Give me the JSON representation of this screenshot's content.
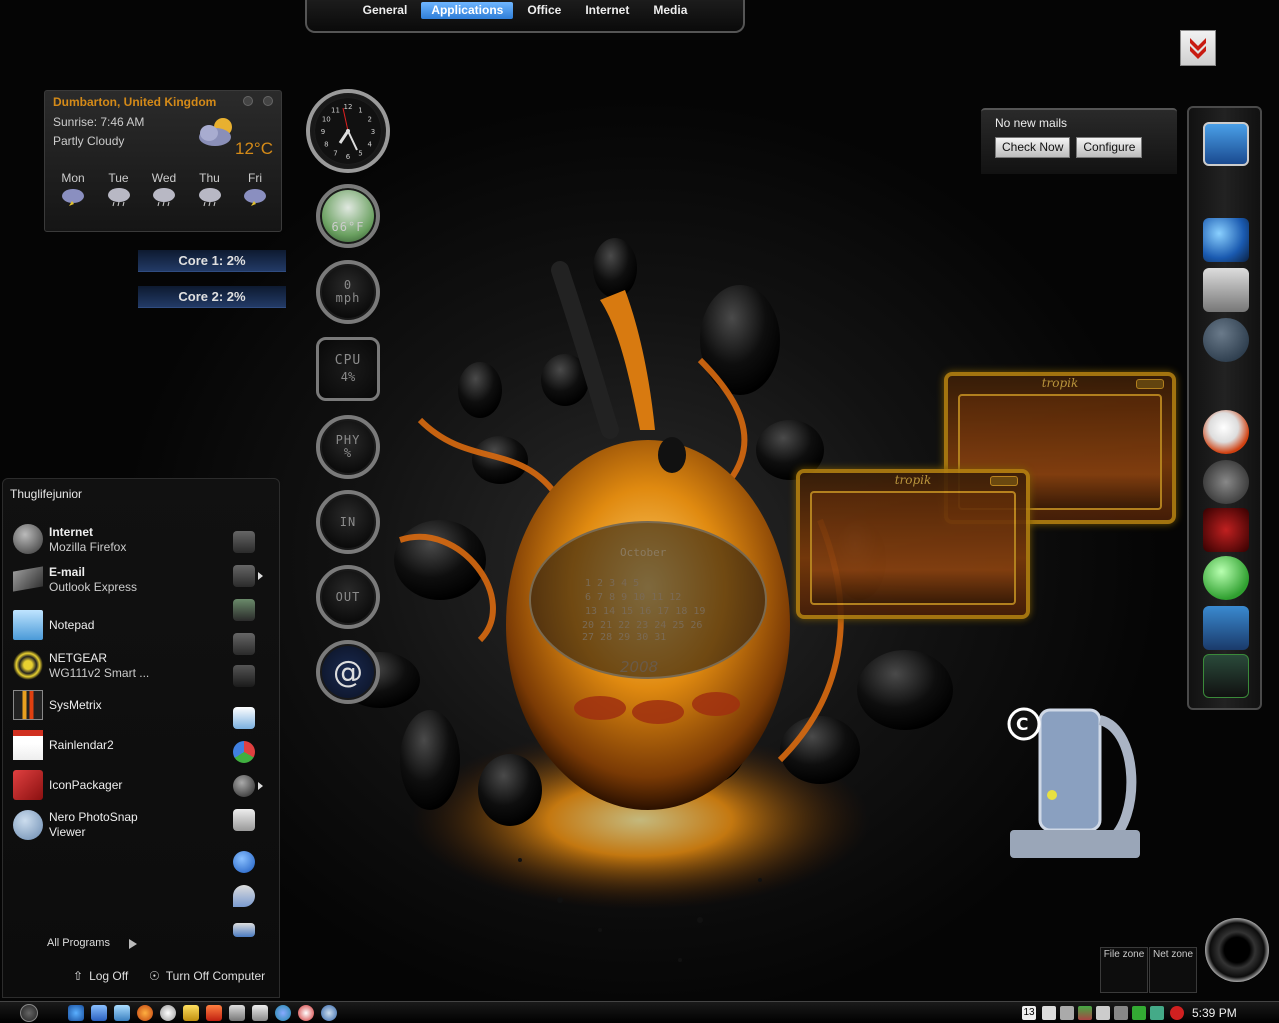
{
  "top_dock": {
    "tabs": [
      "General",
      "Applications",
      "Office",
      "Internet",
      "Media"
    ],
    "active_tab": "Applications"
  },
  "weather": {
    "location": "Dumbarton, United Kingdom",
    "sunrise": "Sunrise: 7:46 AM",
    "condition": "Partly Cloudy",
    "temperature": "12°C",
    "forecast": [
      {
        "day": "Mon",
        "icon": "cloud-storm-icon"
      },
      {
        "day": "Tue",
        "icon": "cloud-rain-icon"
      },
      {
        "day": "Wed",
        "icon": "cloud-rain-icon"
      },
      {
        "day": "Thu",
        "icon": "cloud-rain-icon"
      },
      {
        "day": "Fri",
        "icon": "cloud-storm-icon"
      }
    ]
  },
  "cores": {
    "core1": "Core 1:  2%",
    "core2": "Core 2:  2%"
  },
  "gauges": {
    "clock_numbers": [
      "12",
      "1",
      "2",
      "3",
      "4",
      "5",
      "6",
      "7",
      "8",
      "9",
      "10",
      "11"
    ],
    "temperature": "66°F",
    "speed_value": "0",
    "speed_unit": "mph",
    "cpu_label": "CPU",
    "cpu_value": "4%",
    "phy_label": "PHY",
    "phy_unit": "%",
    "in_label": "IN",
    "out_label": "OUT",
    "mail_symbol": "@"
  },
  "mail": {
    "status": "No new mails",
    "check_now": "Check Now",
    "configure": "Configure"
  },
  "tropik": {
    "title": "tropik"
  },
  "calendar": {
    "month": "October",
    "year": "2008"
  },
  "start_menu": {
    "user": "Thuglifejunior",
    "programs": [
      {
        "name": "Internet",
        "sub": "Mozilla Firefox",
        "bold": true
      },
      {
        "name": "E-mail",
        "sub": "Outlook Express",
        "bold": true
      },
      {
        "name": "Notepad",
        "sub": ""
      },
      {
        "name": "NETGEAR",
        "sub": "WG111v2 Smart ..."
      },
      {
        "name": "SysMetrix",
        "sub": ""
      },
      {
        "name": "Rainlendar2",
        "sub": ""
      },
      {
        "name": "IconPackager",
        "sub": ""
      },
      {
        "name": "Nero PhotoSnap",
        "sub": "Viewer"
      }
    ],
    "all_programs": "All Programs",
    "log_off": "Log Off",
    "turn_off": "Turn Off Computer"
  },
  "zones": {
    "file": "File zone",
    "net": "Net zone"
  },
  "taskbar": {
    "clock": "5:39 PM",
    "tray_date": "13"
  },
  "colors": {
    "accent_orange": "#d48a18",
    "tab_active": "#2f7ed8",
    "tropik_gold": "#b07d10"
  }
}
